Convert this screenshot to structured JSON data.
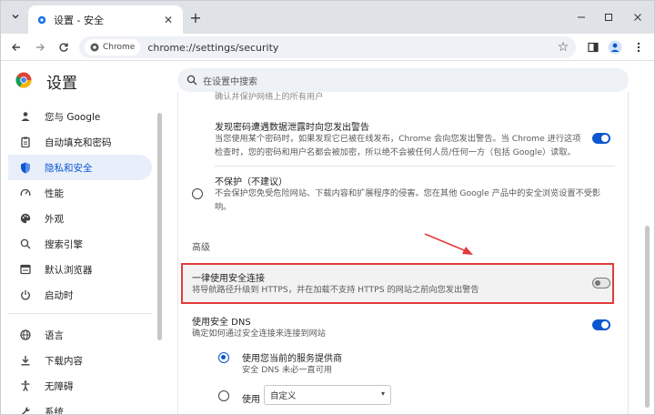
{
  "window": {
    "tab_title": "设置 - 安全",
    "url": "chrome://settings/security",
    "chip_label": "Chrome"
  },
  "settings": {
    "title": "设置",
    "search_placeholder": "在设置中搜索"
  },
  "sidebar": {
    "items": [
      {
        "label": "您与 Google",
        "icon": "person-icon"
      },
      {
        "label": "自动填充和密码",
        "icon": "clipboard-icon"
      },
      {
        "label": "隐私和安全",
        "icon": "shield-icon",
        "active": true
      },
      {
        "label": "性能",
        "icon": "speedometer-icon"
      },
      {
        "label": "外观",
        "icon": "palette-icon"
      },
      {
        "label": "搜索引擎",
        "icon": "search-icon"
      },
      {
        "label": "默认浏览器",
        "icon": "browser-icon"
      },
      {
        "label": "启动时",
        "icon": "power-icon"
      },
      {
        "label": "语言",
        "icon": "globe-icon"
      },
      {
        "label": "下载内容",
        "icon": "download-icon"
      },
      {
        "label": "无障碍",
        "icon": "accessibility-icon"
      },
      {
        "label": "系统",
        "icon": "wrench-icon"
      }
    ]
  },
  "main": {
    "cut_off_text": "确认并保护网络上的所有用户",
    "leak_warning": {
      "title": "发现密码遭遇数据泄露时向您发出警告",
      "desc_line1": "当您使用某个密码时，如果发现它已被在线发布，Chrome 会向您发出警告。当 Chrome 进行这项",
      "desc_line2": "检查时，您的密码和用户名都会被加密，所以绝不会被任何人员/任何一方（包括 Google）读取。",
      "enabled": true
    },
    "no_protection": {
      "title": "不保护（不建议）",
      "desc_line1": "不会保护您免受危险网站、下载内容和扩展程序的侵害。您在其他 Google 产品中的安全浏览设置不受影",
      "desc_line2": "响。",
      "selected": false
    },
    "advanced_label": "高级",
    "https_first": {
      "title": "一律使用安全连接",
      "desc": "将导航路径升级到 HTTPS，并在加载不支持 HTTPS 的网站之前向您发出警告",
      "enabled": false
    },
    "secure_dns": {
      "title": "使用安全 DNS",
      "desc": "确定如何通过安全连接来连接到网站",
      "enabled": true,
      "option_current": {
        "title": "使用您当前的服务提供商",
        "desc": "安全 DNS 未必一直可用",
        "selected": true
      },
      "option_custom": {
        "label": "使用",
        "select_value": "自定义",
        "selected": false
      }
    }
  },
  "colors": {
    "accent": "#0b57d0",
    "highlight_border": "#e23a3a",
    "sidebar_active_bg": "#e8effa"
  }
}
